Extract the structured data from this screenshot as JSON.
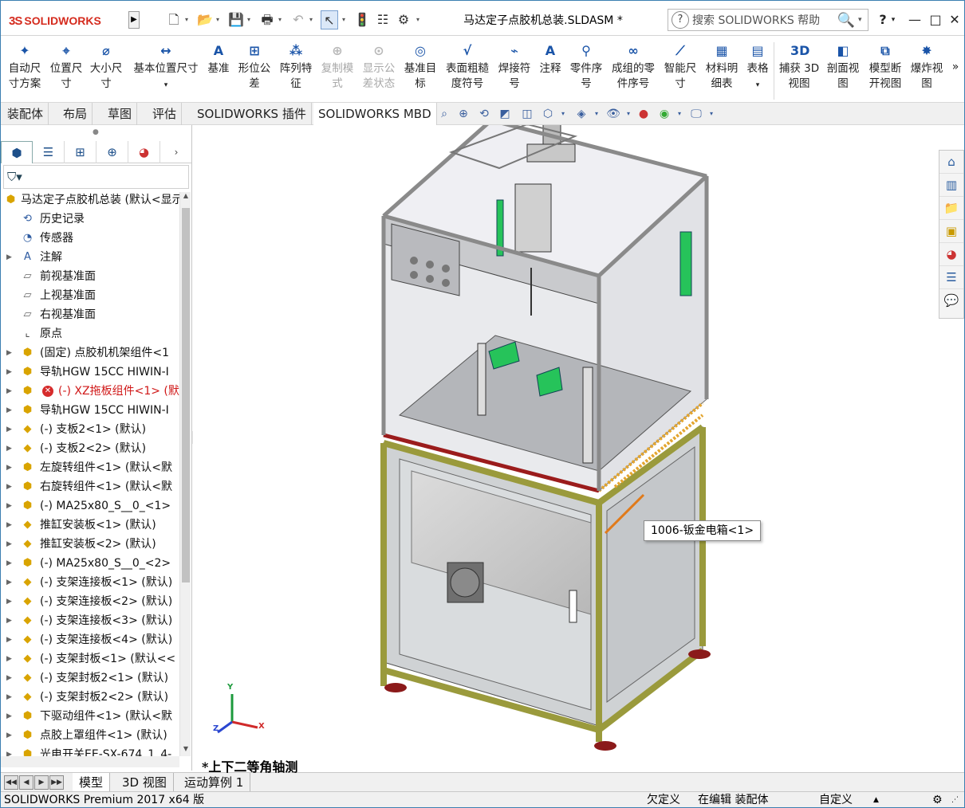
{
  "app": {
    "brand_ds": "3S",
    "brand_name": "SOLIDWORKS"
  },
  "window": {
    "title": "马达定子点胶机总装.SLDASM *"
  },
  "search": {
    "placeholder": "搜索 SOLIDWORKS 帮助",
    "help_icon": "?"
  },
  "window_controls": {
    "help": "?",
    "minimize": "—",
    "restore": "□",
    "close": "✕"
  },
  "ribbon": {
    "buttons": [
      {
        "label": "自动尺\n寸方案",
        "icon": "auto-dimension-icon",
        "enabled": true
      },
      {
        "label": "位置尺\n寸",
        "icon": "location-dimension-icon",
        "enabled": true
      },
      {
        "label": "大小尺\n寸",
        "icon": "size-dimension-icon",
        "enabled": true
      },
      {
        "label": "基本位置尺寸",
        "icon": "basic-location-dimension-icon",
        "enabled": true
      },
      {
        "label": "基准",
        "icon": "datum-icon",
        "enabled": true
      },
      {
        "label": "形位公\n差",
        "icon": "geometric-tolerance-icon",
        "enabled": true
      },
      {
        "label": "阵列特\n征",
        "icon": "pattern-feature-icon",
        "enabled": true
      },
      {
        "label": "复制模\n式",
        "icon": "copy-scheme-icon",
        "enabled": false
      },
      {
        "label": "显示公\n差状态",
        "icon": "show-tolerance-status-icon",
        "enabled": false
      },
      {
        "label": "基准目\n标",
        "icon": "datum-target-icon",
        "enabled": true
      },
      {
        "label": "表面粗糙\n度符号",
        "icon": "surface-finish-icon",
        "enabled": true
      },
      {
        "label": "焊接符\n号",
        "icon": "weld-symbol-icon",
        "enabled": true
      },
      {
        "label": "注释",
        "icon": "note-icon",
        "enabled": true
      },
      {
        "label": "零件序\n号",
        "icon": "balloon-icon",
        "enabled": true
      },
      {
        "label": "成组的零\n件序号",
        "icon": "stacked-balloon-icon",
        "enabled": true
      },
      {
        "label": "智能尺\n寸",
        "icon": "smart-dimension-icon",
        "enabled": true
      },
      {
        "label": "材料明\n细表",
        "icon": "bill-of-materials-icon",
        "enabled": true
      },
      {
        "label": "表格",
        "icon": "table-icon",
        "enabled": true
      },
      {
        "label": "捕获 3D\n视图",
        "icon": "capture-3d-view-icon",
        "enabled": true
      },
      {
        "label": "剖面视\n图",
        "icon": "section-view-icon",
        "enabled": true
      },
      {
        "label": "模型断\n开视图",
        "icon": "model-break-view-icon",
        "enabled": true
      },
      {
        "label": "爆炸视\n图",
        "icon": "exploded-view-icon",
        "enabled": true
      }
    ]
  },
  "command_tabs": [
    "装配体",
    "布局",
    "草图",
    "评估",
    "SOLIDWORKS 插件",
    "SOLIDWORKS MBD"
  ],
  "active_command_tab": "SOLIDWORKS MBD",
  "feature_tree": {
    "root": "马达定子点胶机总装 (默认<显示状态-1>)",
    "items": [
      {
        "label": "历史记录",
        "icon": "history-icon",
        "expandable": false,
        "indent": 1
      },
      {
        "label": "传感器",
        "icon": "sensor-icon",
        "expandable": false,
        "indent": 1
      },
      {
        "label": "注解",
        "icon": "annotations-icon",
        "expandable": true,
        "indent": 1
      },
      {
        "label": "前视基准面",
        "icon": "plane-icon",
        "expandable": false,
        "indent": 1
      },
      {
        "label": "上视基准面",
        "icon": "plane-icon",
        "expandable": false,
        "indent": 1
      },
      {
        "label": "右视基准面",
        "icon": "plane-icon",
        "expandable": false,
        "indent": 1
      },
      {
        "label": "原点",
        "icon": "origin-icon",
        "expandable": false,
        "indent": 1
      },
      {
        "label": "(固定) 点胶机机架组件<1",
        "icon": "subassembly-icon",
        "expandable": true,
        "indent": 1
      },
      {
        "label": "导轨HGW 15CC HIWIN-I",
        "icon": "subassembly-icon",
        "expandable": true,
        "indent": 1
      },
      {
        "label": "(-) XZ拖板组件<1> (默",
        "icon": "subassembly-icon",
        "expandable": true,
        "indent": 1,
        "error": true
      },
      {
        "label": "导轨HGW 15CC HIWIN-I",
        "icon": "subassembly-icon",
        "expandable": true,
        "indent": 1
      },
      {
        "label": "(-) 支板2<1> (默认)",
        "icon": "part-icon",
        "expandable": true,
        "indent": 1
      },
      {
        "label": "(-) 支板2<2> (默认)",
        "icon": "part-icon",
        "expandable": true,
        "indent": 1
      },
      {
        "label": "左旋转组件<1> (默认<默",
        "icon": "subassembly-icon",
        "expandable": true,
        "indent": 1
      },
      {
        "label": "右旋转组件<1> (默认<默",
        "icon": "subassembly-icon",
        "expandable": true,
        "indent": 1
      },
      {
        "label": "(-) MA25x80_S__0_<1>",
        "icon": "subassembly-icon",
        "expandable": true,
        "indent": 1
      },
      {
        "label": "推缸安装板<1> (默认)",
        "icon": "part-icon",
        "expandable": true,
        "indent": 1
      },
      {
        "label": "推缸安装板<2> (默认)",
        "icon": "part-icon",
        "expandable": true,
        "indent": 1
      },
      {
        "label": "(-) MA25x80_S__0_<2>",
        "icon": "subassembly-icon",
        "expandable": true,
        "indent": 1
      },
      {
        "label": "(-) 支架连接板<1> (默认)",
        "icon": "part-icon",
        "expandable": true,
        "indent": 1
      },
      {
        "label": "(-) 支架连接板<2> (默认)",
        "icon": "part-icon",
        "expandable": true,
        "indent": 1
      },
      {
        "label": "(-) 支架连接板<3> (默认)",
        "icon": "part-icon",
        "expandable": true,
        "indent": 1
      },
      {
        "label": "(-) 支架连接板<4> (默认)",
        "icon": "part-icon",
        "expandable": true,
        "indent": 1
      },
      {
        "label": "(-) 支架封板<1> (默认<<",
        "icon": "part-icon",
        "expandable": true,
        "indent": 1
      },
      {
        "label": "(-) 支架封板2<1> (默认)",
        "icon": "part-icon",
        "expandable": true,
        "indent": 1
      },
      {
        "label": "(-) 支架封板2<2> (默认)",
        "icon": "part-icon",
        "expandable": true,
        "indent": 1
      },
      {
        "label": "下驱动组件<1> (默认<默",
        "icon": "subassembly-icon",
        "expandable": true,
        "indent": 1
      },
      {
        "label": "点胶上罩组件<1> (默认)",
        "icon": "subassembly-icon",
        "expandable": true,
        "indent": 1
      },
      {
        "label": "光电开关EE-SX-674_1_4-",
        "icon": "subassembly-icon",
        "expandable": true,
        "indent": 1
      }
    ]
  },
  "viewport": {
    "callout": "1006-钣金电箱<1>",
    "view_name": "*上下二等角轴测",
    "axes": {
      "x": "X",
      "y": "Y",
      "z": "Z"
    }
  },
  "bottom_tabs": [
    "模型",
    "3D 视图",
    "运动算例 1"
  ],
  "active_bottom_tab": "模型",
  "status": {
    "product": "SOLIDWORKS Premium 2017 x64 版",
    "underdefined": "欠定义",
    "editing": "在编辑 装配体",
    "units": "自定义"
  },
  "colors": {
    "accent": "#1a54a8",
    "brand_red": "#d52b1e",
    "error_red": "#d01818",
    "frame_yellow": "#9a9a3c",
    "green_part": "#26c35a"
  }
}
